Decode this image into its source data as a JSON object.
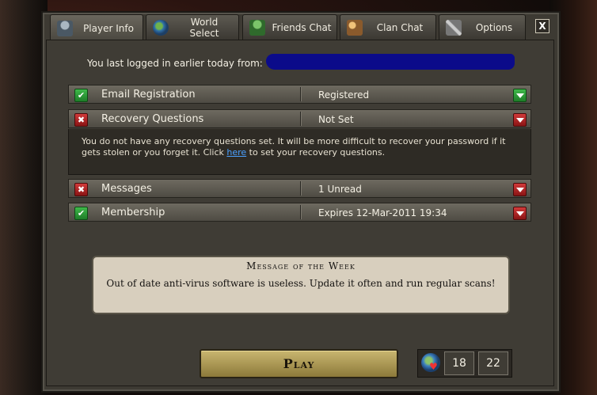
{
  "tabs": [
    {
      "label": "Player Info",
      "icon": "player-icon",
      "active": true
    },
    {
      "label": "World Select",
      "icon": "globe-icon"
    },
    {
      "label": "Friends Chat",
      "icon": "friends-icon"
    },
    {
      "label": "Clan Chat",
      "icon": "clan-icon"
    },
    {
      "label": "Options",
      "icon": "tools-icon"
    }
  ],
  "close_label": "X",
  "last_login": "You last logged in earlier today from:",
  "rows": [
    {
      "label": "Email Registration",
      "value": "Registered",
      "status": "ok",
      "status_glyph": "✔"
    },
    {
      "label": "Recovery Questions",
      "value": "Not Set",
      "status": "bad",
      "status_glyph": "✖"
    },
    {
      "label": "Messages",
      "value": "1 Unread",
      "status": "bad",
      "status_glyph": "✖"
    },
    {
      "label": "Membership",
      "value": "Expires 12-Mar-2011 19:34",
      "status": "ok",
      "status_glyph": "✔"
    }
  ],
  "recovery_info": {
    "text_before": "You do not have any recovery questions set. It will be more difficult to recover your password if it gets stolen or you forget it. Click ",
    "link": "here",
    "text_after": " to set your recovery questions."
  },
  "motw": {
    "title": "Message of the Week",
    "body": "Out of date anti-virus software is useless. Update it often and run regular scans!"
  },
  "play_label": "Play",
  "counters": {
    "first": "18",
    "second": "22"
  }
}
